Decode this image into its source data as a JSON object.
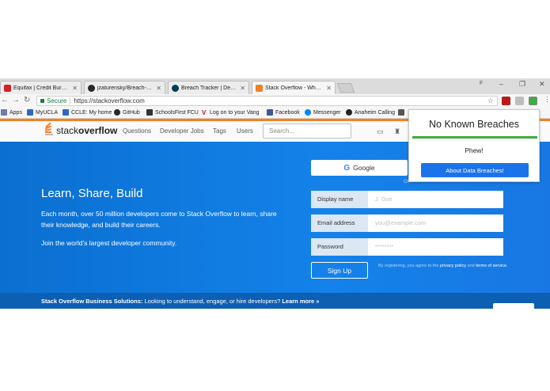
{
  "tabs": [
    {
      "label": "Equifax | Credit Bureau |",
      "color": "#d42027",
      "active": false
    },
    {
      "label": "jzaturensky/Breach-Track",
      "color": "#24292e",
      "active": false
    },
    {
      "label": "Breach Tracker | Devpost",
      "color": "#003e54",
      "active": false
    },
    {
      "label": "Stack Overflow - Where D",
      "color": "#f48024",
      "active": true
    }
  ],
  "window": {
    "minimize": "–",
    "maximize": "❐",
    "close": "✕",
    "profile": "F"
  },
  "address": {
    "secure_label": "Secure",
    "url": "https://stackoverflow.com"
  },
  "bookmarks": [
    {
      "label": "Apps",
      "color": "#6a7ea8"
    },
    {
      "label": "MyUCLA",
      "color": "#2d68c4"
    },
    {
      "label": "CCLE: My home",
      "color": "#2d68c4"
    },
    {
      "label": "GitHub",
      "color": "#24292e"
    },
    {
      "label": "SchoolsFirst FCU",
      "color": "#333333"
    },
    {
      "label": "Log on to your Vang",
      "color": "#c8102e"
    },
    {
      "label": "Facebook",
      "color": "#3b5998"
    },
    {
      "label": "Messenger",
      "color": "#0084ff"
    },
    {
      "label": "Anaheim Calling",
      "color": "#222222"
    }
  ],
  "so": {
    "logo_light": "stack",
    "logo_bold": "overflow",
    "nav": [
      "Questions",
      "Developer Jobs",
      "Tags",
      "Users"
    ],
    "search_placeholder": "Search..."
  },
  "hero": {
    "title": "Learn, Share, Build",
    "text1": "Each month, over 50 million developers come to Stack Overflow to learn, share their knowledge, and build their careers.",
    "text2": "Join the world’s largest developer community.",
    "google_label": "Google",
    "or_label": "OR",
    "fields": [
      {
        "label": "Display name",
        "placeholder": "J. Doe"
      },
      {
        "label": "Email address",
        "placeholder": "you@example.com"
      },
      {
        "label": "Password",
        "placeholder": "********"
      }
    ],
    "signup_label": "Sign Up",
    "legal_pre": "By registering, you agree to the ",
    "legal_privacy": "privacy policy",
    "legal_and": " and ",
    "legal_terms": "terms of service",
    "legal_end": "."
  },
  "biz": {
    "bold": "Stack Overflow Business Solutions:",
    "text": " Looking to understand, engage, or hire developers? ",
    "link": "Learn more »"
  },
  "popup": {
    "title": "No Known Breaches",
    "message": "Phew!",
    "button": "About Data Breaches!",
    "accent": "#3cae3c"
  }
}
